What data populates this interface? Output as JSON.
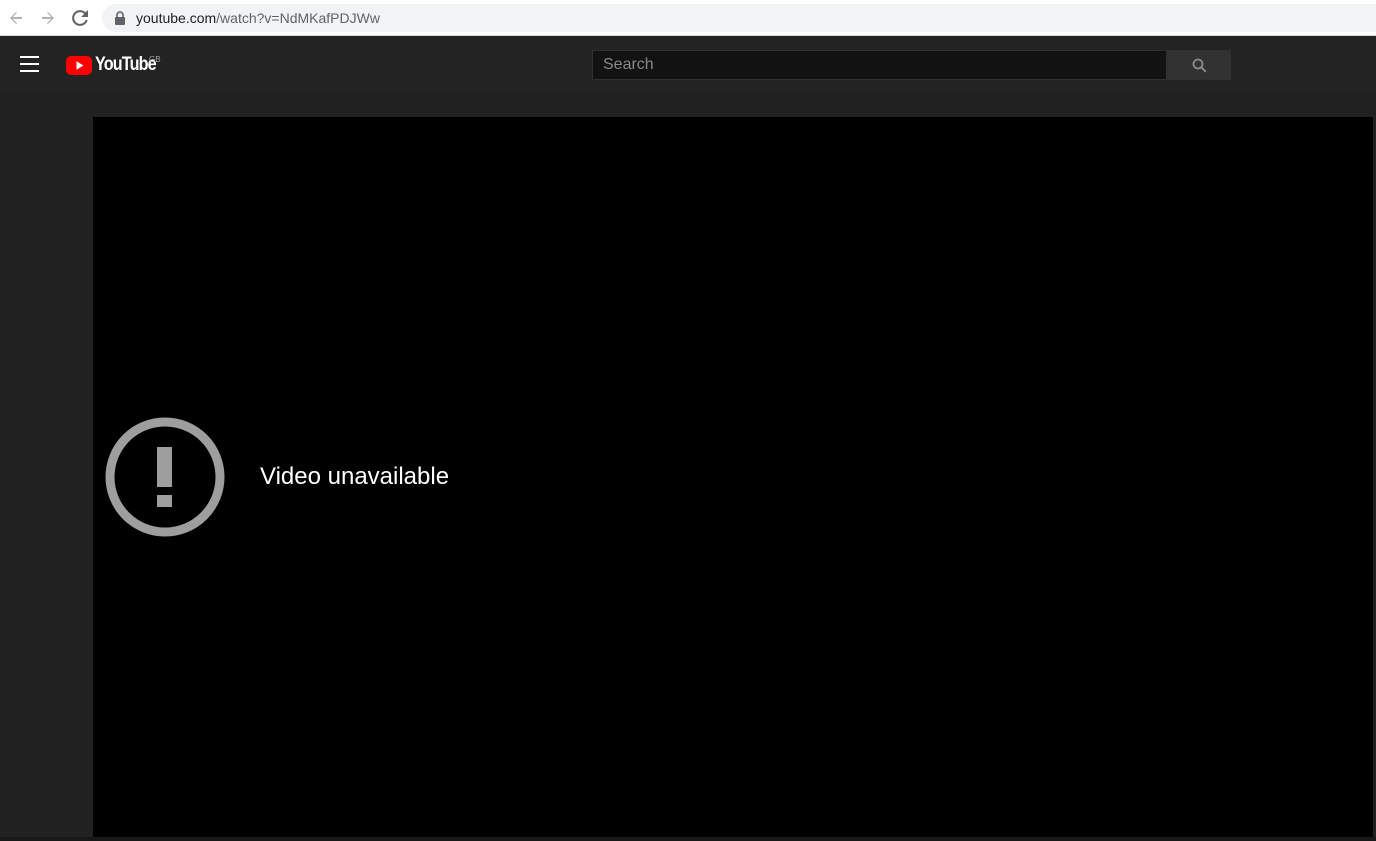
{
  "browser": {
    "url_host": "youtube.com",
    "url_path": "/watch?v=NdMKafPDJWw",
    "icons": [
      "back-arrow-icon",
      "forward-arrow-icon",
      "reload-icon",
      "lock-icon"
    ]
  },
  "masthead": {
    "logo_text": "YouTube",
    "region": "GB",
    "search_placeholder": "Search",
    "search_value": "",
    "icons": [
      "menu-icon",
      "youtube-play-icon",
      "search-icon"
    ]
  },
  "player": {
    "error_message": "Video unavailable",
    "icon": "exclamation-circle-icon"
  },
  "colors": {
    "background": "#212121",
    "masthead": "#232323",
    "brand_red": "#ff0000",
    "player": "#000000",
    "error_icon": "#9e9e9e"
  }
}
